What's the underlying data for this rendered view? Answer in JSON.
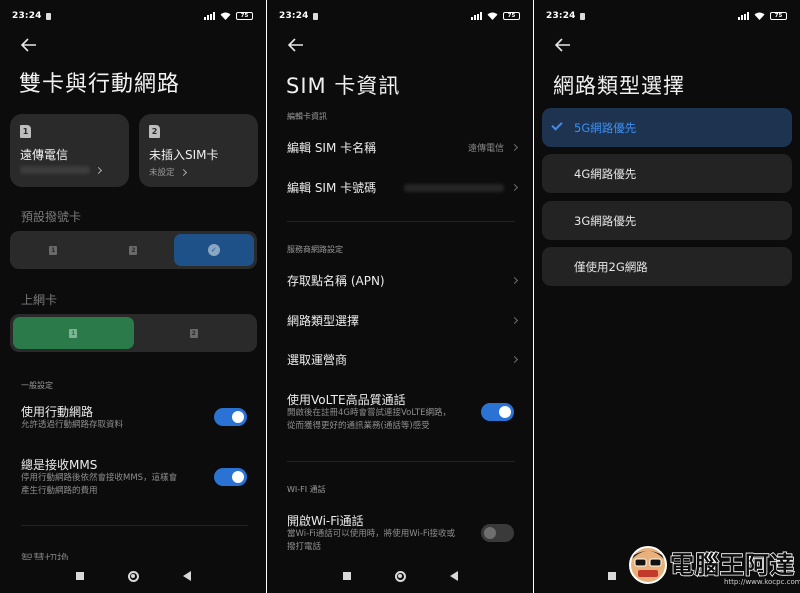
{
  "status": {
    "time": "23:24",
    "battery": "75"
  },
  "panel1": {
    "title": "雙卡與行動網路",
    "sim1": {
      "num": "1",
      "name": "遠傳電信"
    },
    "sim2": {
      "num": "2",
      "name": "未插入SIM卡",
      "sub": "未設定"
    },
    "default_call_label": "預設撥號卡",
    "data_card_label": "上網卡",
    "seg_sim1": "1",
    "seg_sim2": "2",
    "general_label": "一般設定",
    "mobile_data_title": "使用行動網路",
    "mobile_data_desc": "允許透過行動網路存取資料",
    "mms_title": "總是接收MMS",
    "mms_desc1": "停用行動網路後依然會接收MMS，這樣會",
    "mms_desc2": "產生行動網路的費用",
    "cut_off": "智慧切換"
  },
  "panel2": {
    "title": "SIM 卡資訊",
    "edit_hdr": "編輯卡資訊",
    "edit_name": "編輯 SIM 卡名稱",
    "edit_name_val": "遠傳電信",
    "edit_number": "編輯 SIM 卡號碼",
    "carrier_hdr": "服務商網路設定",
    "apn": "存取點名稱 (APN)",
    "net_type": "網路類型選擇",
    "operator": "選取運營商",
    "volte_title": "使用VoLTE高品質通話",
    "volte_desc1": "開啟後在註冊4G時會嘗試連接VoLTE網路，",
    "volte_desc2": "從而獲得更好的通訊業務(通話等)感受",
    "wifi_hdr": "WI-FI 通話",
    "wifi_title": "開啟Wi-Fi通話",
    "wifi_desc1": "當Wi-Fi通話可以使用時，將使用Wi-Fi接收或",
    "wifi_desc2": "撥打電話"
  },
  "panel3": {
    "title": "網路類型選擇",
    "options": [
      "5G網路優先",
      "4G網路優先",
      "3G網路優先",
      "僅使用2G網路"
    ],
    "selected": "5G網路優先"
  },
  "watermark": {
    "text": "電腦王阿達",
    "url": "http://www.kocpc.com.tw"
  },
  "colors": {
    "accent": "#2a72d4",
    "selected_bg": "#1d3350",
    "green": "#2a7a4a"
  }
}
